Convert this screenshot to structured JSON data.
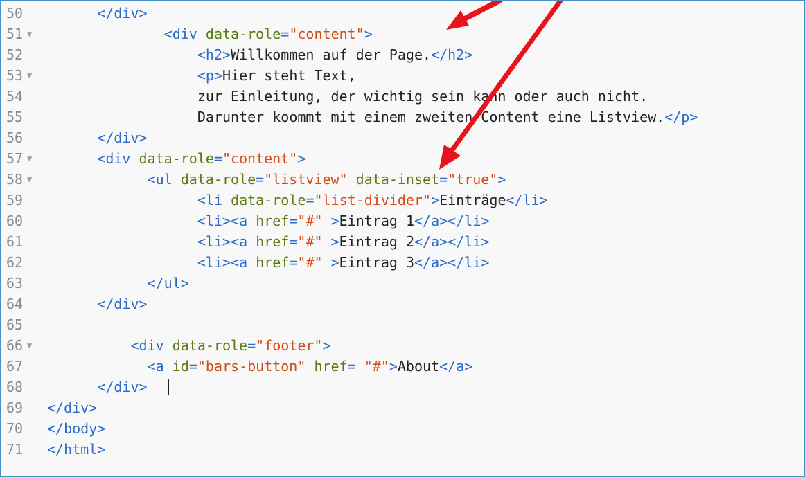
{
  "editor": {
    "lines": [
      {
        "num": "50",
        "fold": false,
        "indent": 3,
        "tokens": [
          [
            "tag",
            "</div>"
          ]
        ]
      },
      {
        "num": "51",
        "fold": true,
        "indent": 7,
        "tokens": [
          [
            "tag",
            "<div "
          ],
          [
            "attr",
            "data-role"
          ],
          [
            "tag",
            "="
          ],
          [
            "str",
            "\"content\""
          ],
          [
            "tag",
            ">"
          ]
        ]
      },
      {
        "num": "52",
        "fold": false,
        "indent": 9,
        "tokens": [
          [
            "tag",
            "<h2>"
          ],
          [
            "txt",
            "Willkommen auf der Page."
          ],
          [
            "tag",
            "</h2>"
          ]
        ]
      },
      {
        "num": "53",
        "fold": true,
        "indent": 9,
        "tokens": [
          [
            "tag",
            "<p>"
          ],
          [
            "txt",
            "Hier steht Text,"
          ]
        ]
      },
      {
        "num": "54",
        "fold": false,
        "indent": 9,
        "tokens": [
          [
            "txt",
            "zur Einleitung, der wichtig sein kann oder auch nicht."
          ]
        ]
      },
      {
        "num": "55",
        "fold": false,
        "indent": 9,
        "tokens": [
          [
            "txt",
            "Darunter koommt mit einem zweiten Content eine Listview."
          ],
          [
            "tag",
            "</p>"
          ]
        ]
      },
      {
        "num": "56",
        "fold": false,
        "indent": 3,
        "tokens": [
          [
            "tag",
            "</div>"
          ]
        ]
      },
      {
        "num": "57",
        "fold": true,
        "indent": 3,
        "tokens": [
          [
            "tag",
            "<div "
          ],
          [
            "attr",
            "data-role"
          ],
          [
            "tag",
            "="
          ],
          [
            "str",
            "\"content\""
          ],
          [
            "tag",
            ">"
          ]
        ]
      },
      {
        "num": "58",
        "fold": true,
        "indent": 6,
        "tokens": [
          [
            "tag",
            "<ul "
          ],
          [
            "attr",
            "data-role"
          ],
          [
            "tag",
            "="
          ],
          [
            "str",
            "\"listview\""
          ],
          [
            "tag",
            " "
          ],
          [
            "attr",
            "data-inset"
          ],
          [
            "tag",
            "="
          ],
          [
            "str",
            "\"true\""
          ],
          [
            "tag",
            ">"
          ]
        ]
      },
      {
        "num": "59",
        "fold": false,
        "indent": 9,
        "tokens": [
          [
            "tag",
            "<li "
          ],
          [
            "attr",
            "data-role"
          ],
          [
            "tag",
            "="
          ],
          [
            "str",
            "\"list-divider\""
          ],
          [
            "tag",
            ">"
          ],
          [
            "txt",
            "Einträge"
          ],
          [
            "tag",
            "</li>"
          ]
        ]
      },
      {
        "num": "60",
        "fold": false,
        "indent": 9,
        "tokens": [
          [
            "tag",
            "<li><a "
          ],
          [
            "attr",
            "href"
          ],
          [
            "tag",
            "="
          ],
          [
            "str",
            "\"#\""
          ],
          [
            "tag",
            " >"
          ],
          [
            "txt",
            "Eintrag 1"
          ],
          [
            "tag",
            "</a></li>"
          ]
        ]
      },
      {
        "num": "61",
        "fold": false,
        "indent": 9,
        "tokens": [
          [
            "tag",
            "<li><a "
          ],
          [
            "attr",
            "href"
          ],
          [
            "tag",
            "="
          ],
          [
            "str",
            "\"#\""
          ],
          [
            "tag",
            " >"
          ],
          [
            "txt",
            "Eintrag 2"
          ],
          [
            "tag",
            "</a></li>"
          ]
        ]
      },
      {
        "num": "62",
        "fold": false,
        "indent": 9,
        "tokens": [
          [
            "tag",
            "<li><a "
          ],
          [
            "attr",
            "href"
          ],
          [
            "tag",
            "="
          ],
          [
            "str",
            "\"#\""
          ],
          [
            "tag",
            " >"
          ],
          [
            "txt",
            "Eintrag 3"
          ],
          [
            "tag",
            "</a></li>"
          ]
        ]
      },
      {
        "num": "63",
        "fold": false,
        "indent": 6,
        "tokens": [
          [
            "tag",
            "</ul>"
          ]
        ]
      },
      {
        "num": "64",
        "fold": false,
        "indent": 3,
        "tokens": [
          [
            "tag",
            "</div>"
          ]
        ]
      },
      {
        "num": "65",
        "fold": false,
        "indent": 0,
        "tokens": []
      },
      {
        "num": "66",
        "fold": true,
        "indent": 5,
        "tokens": [
          [
            "tag",
            "<div "
          ],
          [
            "attr",
            "data-role"
          ],
          [
            "tag",
            "="
          ],
          [
            "str",
            "\"footer\""
          ],
          [
            "tag",
            ">"
          ]
        ]
      },
      {
        "num": "67",
        "fold": false,
        "indent": 6,
        "tokens": [
          [
            "tag",
            "<a "
          ],
          [
            "attr",
            "id"
          ],
          [
            "tag",
            "="
          ],
          [
            "str",
            "\"bars-button\""
          ],
          [
            "tag",
            " "
          ],
          [
            "attr",
            "href"
          ],
          [
            "tag",
            "= "
          ],
          [
            "str",
            "\"#\""
          ],
          [
            "tag",
            ">"
          ],
          [
            "txt",
            "About"
          ],
          [
            "tag",
            "</a>"
          ]
        ]
      },
      {
        "num": "68",
        "fold": false,
        "indent": 3,
        "tokens": [
          [
            "tag",
            "</div> "
          ]
        ]
      },
      {
        "num": "69",
        "fold": false,
        "indent": 0,
        "tokens": [
          [
            "tag",
            "</div>"
          ]
        ]
      },
      {
        "num": "70",
        "fold": false,
        "indent": 0,
        "tokens": [
          [
            "tag",
            "</body>"
          ]
        ]
      },
      {
        "num": "71",
        "fold": false,
        "indent": 0,
        "tokens": [
          [
            "tag",
            "</html>"
          ]
        ]
      }
    ],
    "fold_glyph": "▼"
  },
  "colors": {
    "tag": "#2a6cc8",
    "attr": "#5b7a10",
    "string": "#d44b16",
    "text": "#222222",
    "line_number": "#8a8a8a",
    "annotation_arrow": "#e8141c"
  }
}
